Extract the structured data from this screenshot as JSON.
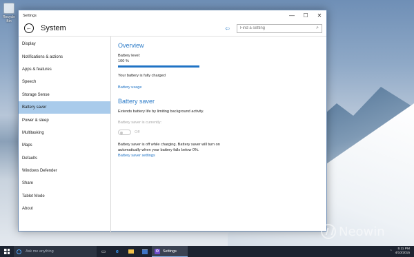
{
  "desktop": {
    "icon_label": "Recycle Bin"
  },
  "window": {
    "title": "Settings",
    "controls": {
      "minimize": "—",
      "maximize": "☐",
      "close": "✕"
    }
  },
  "header": {
    "back_icon": "back-arrow-icon",
    "title": "System",
    "pin_icon": "pin-icon",
    "search": {
      "placeholder": "Find a setting",
      "value": "",
      "icon": "search-icon"
    }
  },
  "sidebar": {
    "items": [
      {
        "label": "Display"
      },
      {
        "label": "Notifications & actions"
      },
      {
        "label": "Apps & features"
      },
      {
        "label": "Speech"
      },
      {
        "label": "Storage Sense"
      },
      {
        "label": "Battery saver",
        "selected": true
      },
      {
        "label": "Power & sleep"
      },
      {
        "label": "Multitasking"
      },
      {
        "label": "Maps"
      },
      {
        "label": "Defaults"
      },
      {
        "label": "Windows Defender"
      },
      {
        "label": "Share"
      },
      {
        "label": "Tablet Mode"
      },
      {
        "label": "About"
      }
    ]
  },
  "overview": {
    "heading": "Overview",
    "battery_level_label": "Battery level:",
    "battery_level_value": "100 %",
    "battery_level_fraction": 1.0,
    "status": "Your battery is fully charged",
    "usage_link": "Battery usage"
  },
  "battery_saver": {
    "heading": "Battery saver",
    "description": "Extends battery life by limiting background activity.",
    "currently_label": "Battery saver is currently:",
    "toggle_state": "Off",
    "note": "Battery saver is off while charging. Battery saver will turn on automatically when your battery falls below 0%.",
    "settings_link": "Battery saver settings"
  },
  "taskbar": {
    "search_placeholder": "Ask me anything",
    "active_app": "Settings",
    "time": "5:11 PM",
    "date": "4/10/2015"
  },
  "watermark": {
    "text": "Neowin"
  },
  "colors": {
    "accent": "#1f73c5",
    "selected_nav": "#a9cbeb",
    "taskbar": "#1c2330"
  }
}
